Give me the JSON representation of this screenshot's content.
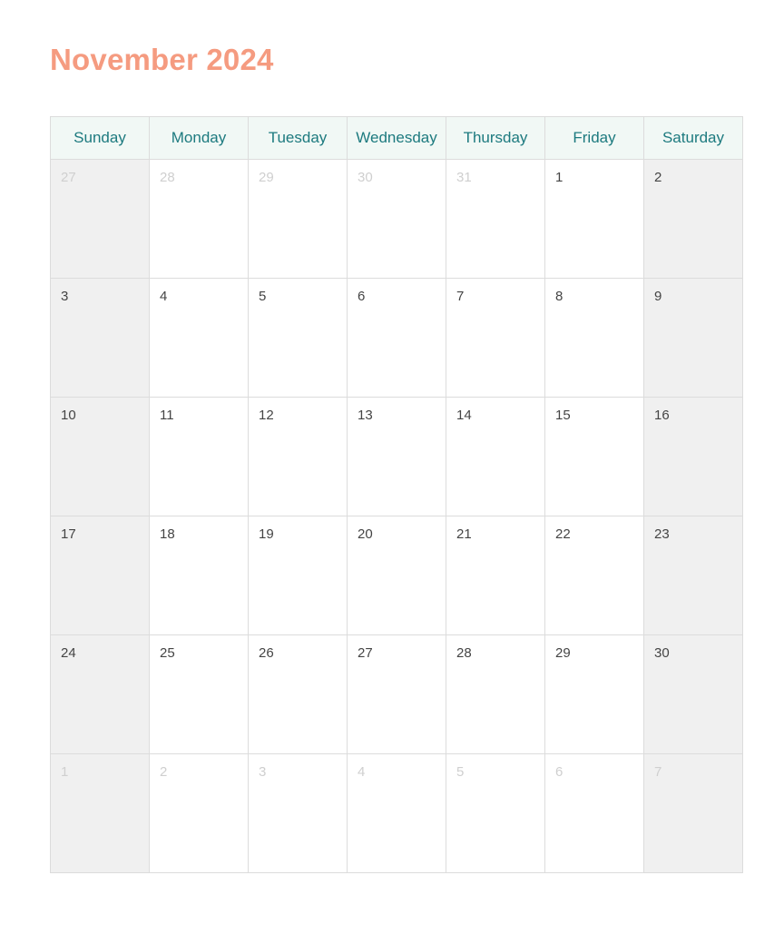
{
  "calendar": {
    "title": "November 2024",
    "month": "November",
    "year": "2024",
    "title_color": "#F59B80",
    "header_text_color": "#1d7a7f",
    "header_bg_color": "#f1f8f5",
    "weekend_bg_color": "#f0f0f0",
    "other_month_text_color": "#cfcfcf",
    "weekday_headers": [
      "Sunday",
      "Monday",
      "Tuesday",
      "Wednesday",
      "Thursday",
      "Friday",
      "Saturday"
    ],
    "weeks": [
      {
        "days": [
          {
            "label": "27",
            "in_month": false
          },
          {
            "label": "28",
            "in_month": false
          },
          {
            "label": "29",
            "in_month": false
          },
          {
            "label": "30",
            "in_month": false
          },
          {
            "label": "31",
            "in_month": false
          },
          {
            "label": "1",
            "in_month": true
          },
          {
            "label": "2",
            "in_month": true
          }
        ]
      },
      {
        "days": [
          {
            "label": "3",
            "in_month": true
          },
          {
            "label": "4",
            "in_month": true
          },
          {
            "label": "5",
            "in_month": true
          },
          {
            "label": "6",
            "in_month": true
          },
          {
            "label": "7",
            "in_month": true
          },
          {
            "label": "8",
            "in_month": true
          },
          {
            "label": "9",
            "in_month": true
          }
        ]
      },
      {
        "days": [
          {
            "label": "10",
            "in_month": true
          },
          {
            "label": "11",
            "in_month": true
          },
          {
            "label": "12",
            "in_month": true
          },
          {
            "label": "13",
            "in_month": true
          },
          {
            "label": "14",
            "in_month": true
          },
          {
            "label": "15",
            "in_month": true
          },
          {
            "label": "16",
            "in_month": true
          }
        ]
      },
      {
        "days": [
          {
            "label": "17",
            "in_month": true
          },
          {
            "label": "18",
            "in_month": true
          },
          {
            "label": "19",
            "in_month": true
          },
          {
            "label": "20",
            "in_month": true
          },
          {
            "label": "21",
            "in_month": true
          },
          {
            "label": "22",
            "in_month": true
          },
          {
            "label": "23",
            "in_month": true
          }
        ]
      },
      {
        "days": [
          {
            "label": "24",
            "in_month": true
          },
          {
            "label": "25",
            "in_month": true
          },
          {
            "label": "26",
            "in_month": true
          },
          {
            "label": "27",
            "in_month": true
          },
          {
            "label": "28",
            "in_month": true
          },
          {
            "label": "29",
            "in_month": true
          },
          {
            "label": "30",
            "in_month": true
          }
        ]
      },
      {
        "days": [
          {
            "label": "1",
            "in_month": false
          },
          {
            "label": "2",
            "in_month": false
          },
          {
            "label": "3",
            "in_month": false
          },
          {
            "label": "4",
            "in_month": false
          },
          {
            "label": "5",
            "in_month": false
          },
          {
            "label": "6",
            "in_month": false
          },
          {
            "label": "7",
            "in_month": false
          }
        ]
      }
    ]
  }
}
